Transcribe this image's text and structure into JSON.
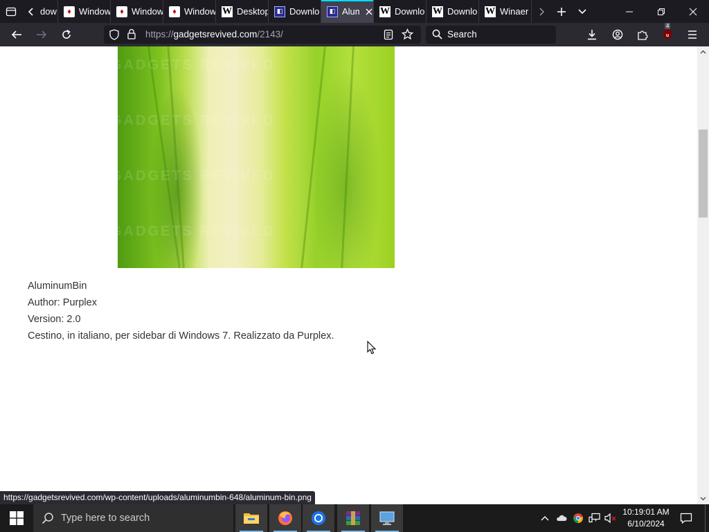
{
  "tabs": [
    {
      "title": "dow",
      "favicon": "partial"
    },
    {
      "title": "Windows",
      "favicon": "card-icon"
    },
    {
      "title": "Windows",
      "favicon": "card-icon"
    },
    {
      "title": "Windows",
      "favicon": "card-icon"
    },
    {
      "title": "Desktop",
      "favicon": "w-icon"
    },
    {
      "title": "Downlo",
      "favicon": "download-icon"
    },
    {
      "title": "Alum",
      "favicon": "download-icon",
      "active": true
    },
    {
      "title": "Downlo",
      "favicon": "w-icon"
    },
    {
      "title": "Downlo",
      "favicon": "w-icon"
    },
    {
      "title": "Winaer",
      "favicon": "w-icon"
    }
  ],
  "address": {
    "scheme": "https://",
    "host": "gadgetsrevived.com",
    "path": "/2143/"
  },
  "search": {
    "placeholder": "Search"
  },
  "extension_badge": "4",
  "favicon_glyphs": {
    "w": "W",
    "card": "♦",
    "dl": "◧"
  },
  "hero_watermark": "GADGETS REVIVED",
  "item": {
    "name": "AluminumBin",
    "author": "Author: Purplex",
    "version": "Version: 2.0",
    "description": "Cestino, in italiano, per sidebar di Windows 7. Realizzato da Purplex."
  },
  "status_url": "https://gadgetsrevived.com/wp-content/uploads/aluminumbin-648/aluminum-bin.png",
  "taskbar": {
    "search_placeholder": "Type here to search",
    "time": "10:19:01 AM",
    "date": "6/10/2024"
  },
  "colors": {
    "accent": "#00ddff",
    "tab_bg": "#1c1b22",
    "toolbar_bg": "#2b2a33"
  }
}
